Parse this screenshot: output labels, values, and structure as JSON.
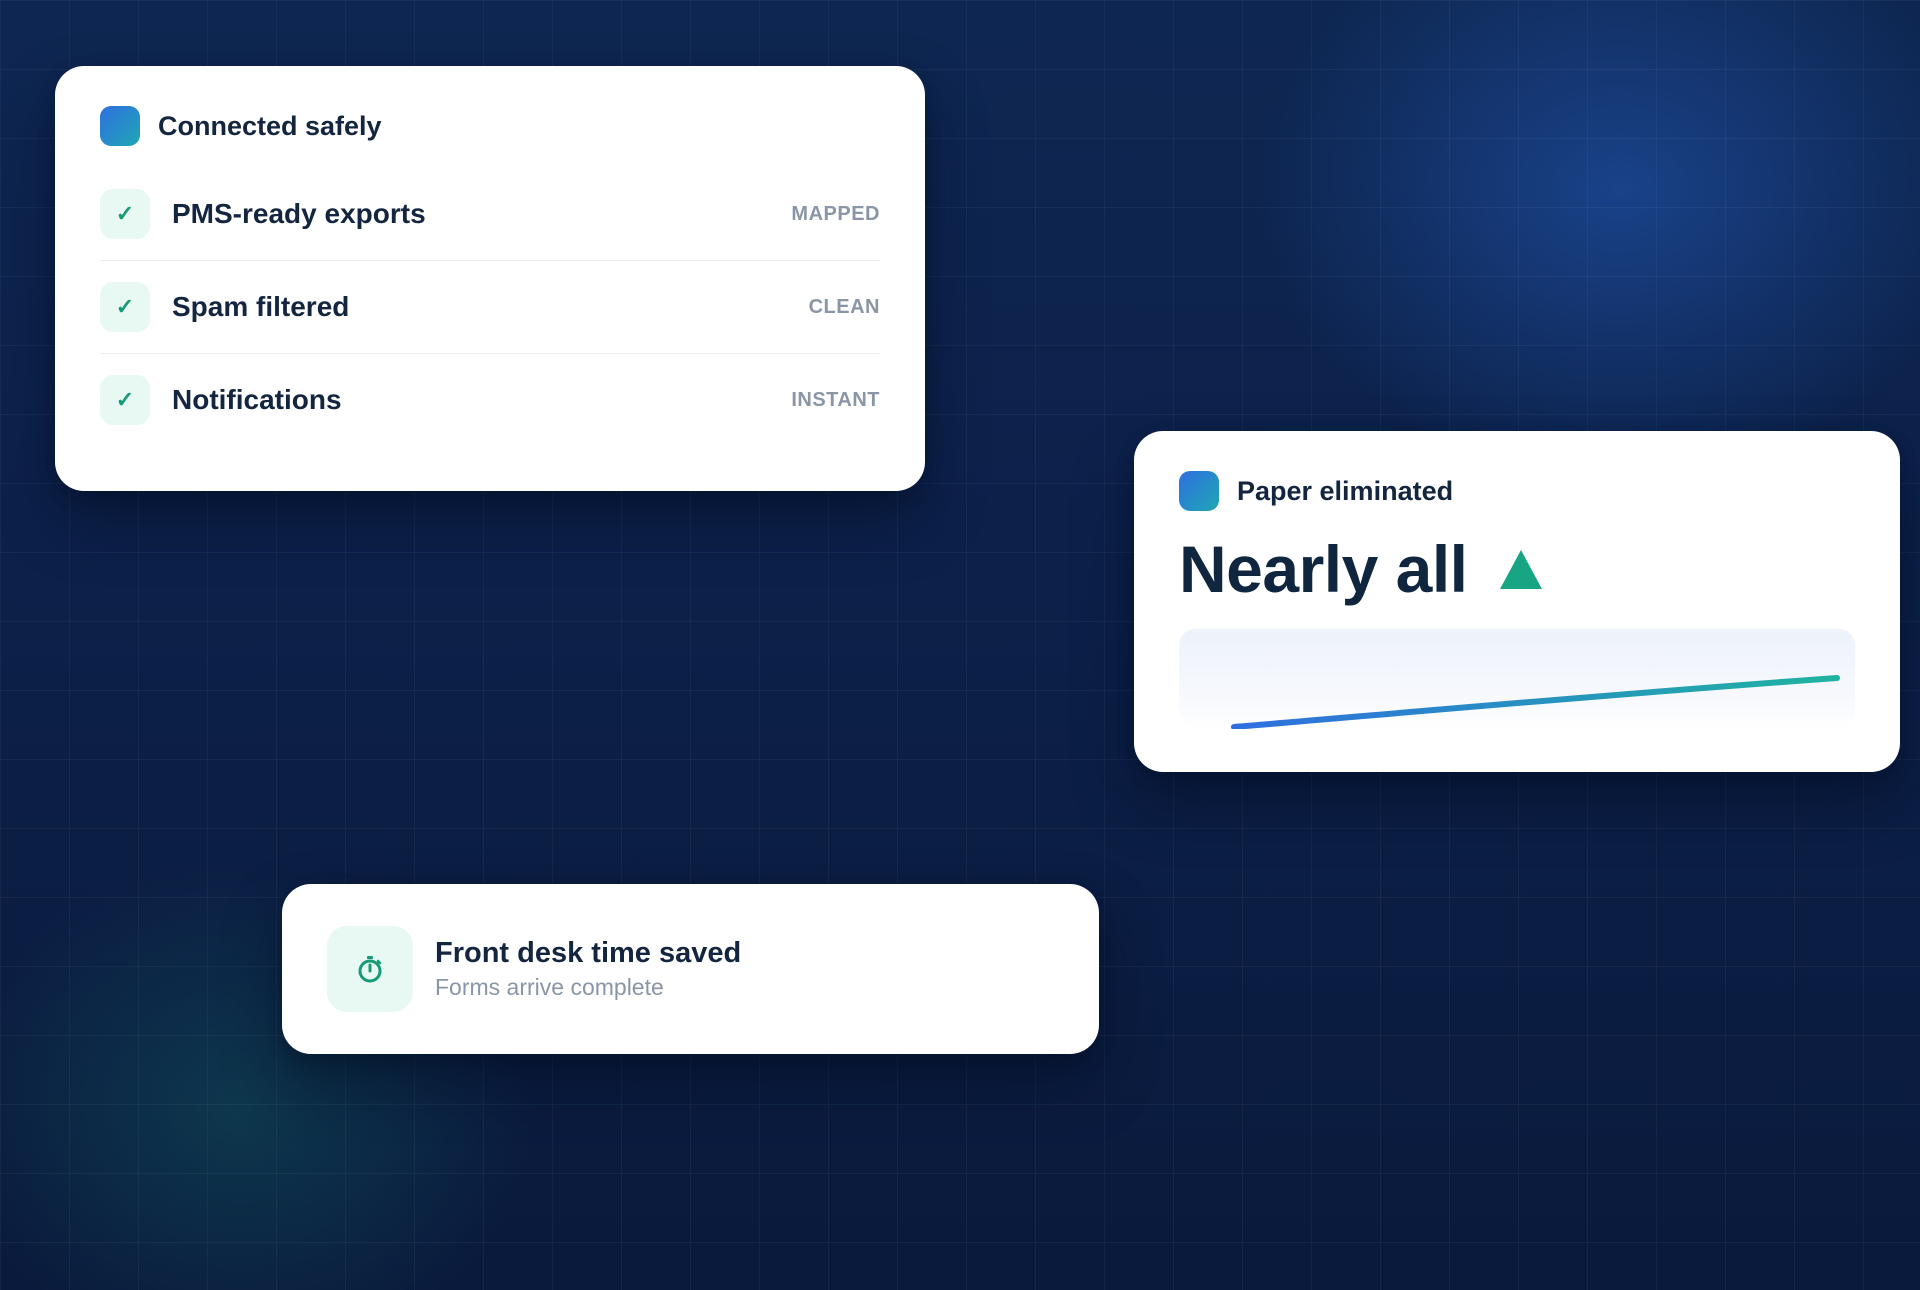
{
  "connected_card": {
    "title": "Connected safely",
    "items": [
      {
        "label": "PMS-ready exports",
        "status": "MAPPED",
        "icon": "check-icon"
      },
      {
        "label": "Spam filtered",
        "status": "CLEAN",
        "icon": "check-icon"
      },
      {
        "label": "Notifications",
        "status": "INSTANT",
        "icon": "check-icon"
      }
    ]
  },
  "paper_card": {
    "title": "Paper eliminated",
    "value": "Nearly all",
    "trend_icon": "triangle-up-icon",
    "trend_color": "#17a584"
  },
  "front_desk_card": {
    "icon": "stopwatch-icon",
    "title": "Front desk time saved",
    "subtitle": "Forms arrive complete"
  },
  "colors": {
    "background": "#0c2049",
    "brand_gradient_start": "#2f6fe0",
    "brand_gradient_end": "#1fa7b4",
    "accent_green": "#169b78",
    "text_dark": "#14263f",
    "text_muted": "#8a96a6"
  }
}
